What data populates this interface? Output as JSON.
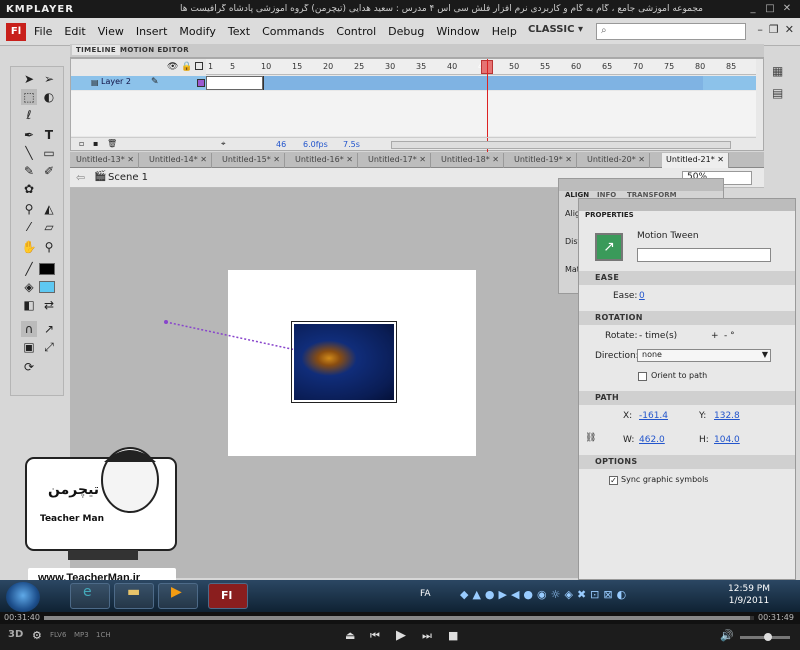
{
  "player": {
    "logo": "KMPLAYER",
    "title": "مجموعه آموزشی جامع ، گام به گام و کاربردی نرم افزار فلش سی اس ۴ مدرس : سعید هدایی (تیچرمن) گروه آموزشی پادشاه گرافیست ها",
    "time_left": "00:31:40",
    "time_right": "00:31:49",
    "badges": [
      "FLV6",
      "MP3",
      "1CH"
    ],
    "mode_3d": "3D"
  },
  "flash": {
    "logo": "Fl",
    "menus": [
      "File",
      "Edit",
      "View",
      "Insert",
      "Modify",
      "Text",
      "Commands",
      "Control",
      "Debug",
      "Window",
      "Help"
    ],
    "workspace": "CLASSIC",
    "timeline_tabs": [
      "TIMELINE",
      "MOTION EDITOR"
    ],
    "ruler_ticks": [
      "1",
      "5",
      "10",
      "15",
      "20",
      "25",
      "30",
      "35",
      "40",
      "45",
      "50",
      "55",
      "60",
      "65",
      "70",
      "75",
      "80",
      "85"
    ],
    "current_frame": "46",
    "layer_name": "Layer 2",
    "fps": "6.0fps",
    "seconds": "7.5s",
    "doc_tabs": [
      "Untitled-13*",
      "Untitled-14*",
      "Untitled-15*",
      "Untitled-16*",
      "Untitled-17*",
      "Untitled-18*",
      "Untitled-19*",
      "Untitled-20*",
      "Untitled-21*"
    ],
    "active_doc": "Untitled-21*",
    "scene": "Scene 1",
    "zoom": "50%",
    "align_tabs": [
      "ALIGN",
      "INFO",
      "TRANSFORM"
    ],
    "align_labels": [
      "Alig",
      "Dist",
      "Mat"
    ],
    "properties": {
      "tab": "PROPERTIES",
      "type": "Motion Tween",
      "ease_header": "EASE",
      "ease_label": "Ease:",
      "ease_value": "0",
      "rotation_header": "ROTATION",
      "rotate_label": "Rotate:",
      "rotate_value": "- time(s)",
      "rotate_plus": "+",
      "rotate_deg": "- °",
      "direction_label": "Direction:",
      "direction_value": "none",
      "orient_label": "Orient to path",
      "path_header": "PATH",
      "x_label": "X:",
      "x_value": "-161.4",
      "y_label": "Y:",
      "y_value": "132.8",
      "w_label": "W:",
      "w_value": "462.0",
      "h_label": "H:",
      "h_value": "104.0",
      "options_header": "OPTIONS",
      "sync_label": "Sync graphic symbols"
    }
  },
  "overlay": {
    "brand_fa": "تیچرمن",
    "brand_en": "Teacher Man",
    "site": "www.TeacherMan.ir"
  },
  "taskbar": {
    "lang": "FA",
    "time": "12:59 PM",
    "date": "1/9/2011",
    "fl_label": "Fl"
  }
}
